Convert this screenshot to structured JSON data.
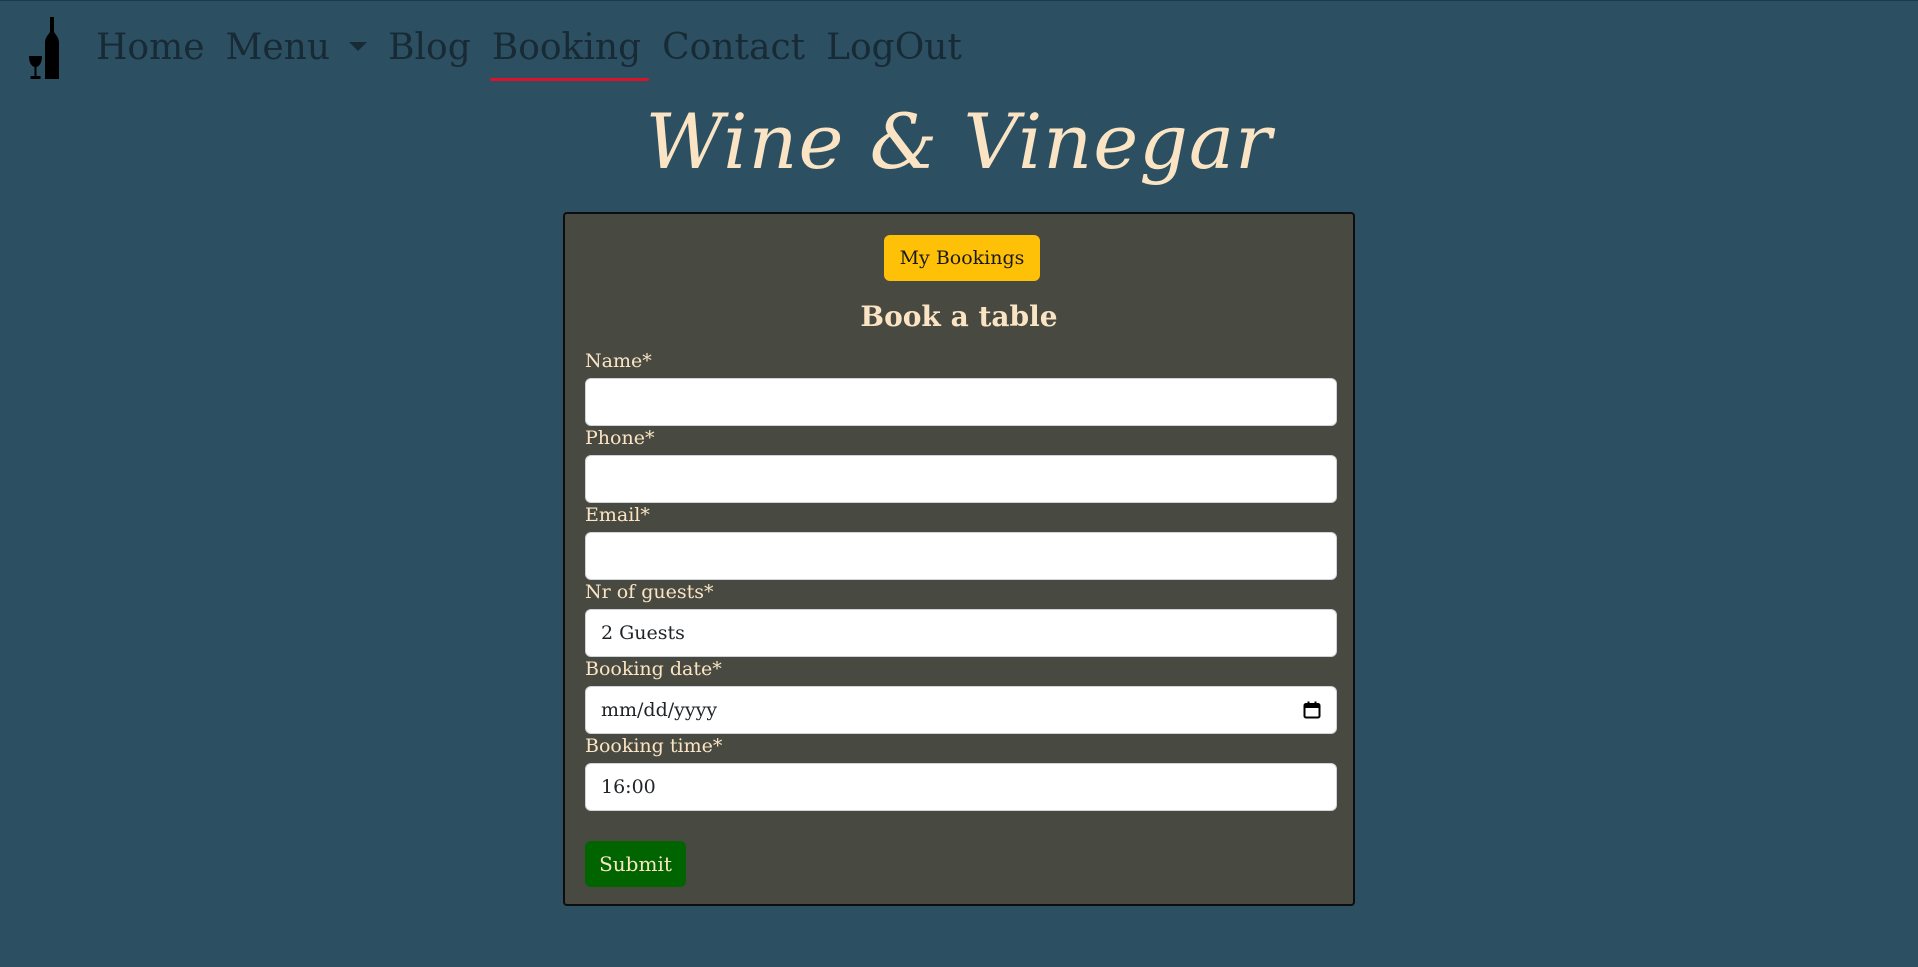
{
  "nav": {
    "logo_icon": "wine-bottle-and-glass-icon",
    "items": [
      {
        "label": "Home"
      },
      {
        "label": "Menu"
      },
      {
        "label": "Blog"
      },
      {
        "label": "Booking",
        "active": true
      },
      {
        "label": "Contact"
      },
      {
        "label": "LogOut"
      }
    ]
  },
  "site_title": "Wine & Vinegar",
  "booking_form": {
    "my_bookings_label": "My Bookings",
    "title": "Book a table",
    "fields": {
      "name": {
        "label": "Name*",
        "value": ""
      },
      "phone": {
        "label": "Phone*",
        "value": ""
      },
      "email": {
        "label": "Email*",
        "value": ""
      },
      "guests": {
        "label": "Nr of guests*",
        "value": "2 Guests"
      },
      "date": {
        "label": "Booking date*",
        "placeholder": "mm/dd/yyyy"
      },
      "time": {
        "label": "Booking time*",
        "value": "16:00"
      }
    },
    "submit_label": "Submit"
  },
  "colors": {
    "background": "#2c5062",
    "card_background": "#484a41",
    "accent_cream": "#fbe4c4",
    "my_bookings_button": "#ffc107",
    "submit_button": "#006400",
    "active_nav_underline": "#d8142a",
    "nav_text": "#172a35"
  }
}
